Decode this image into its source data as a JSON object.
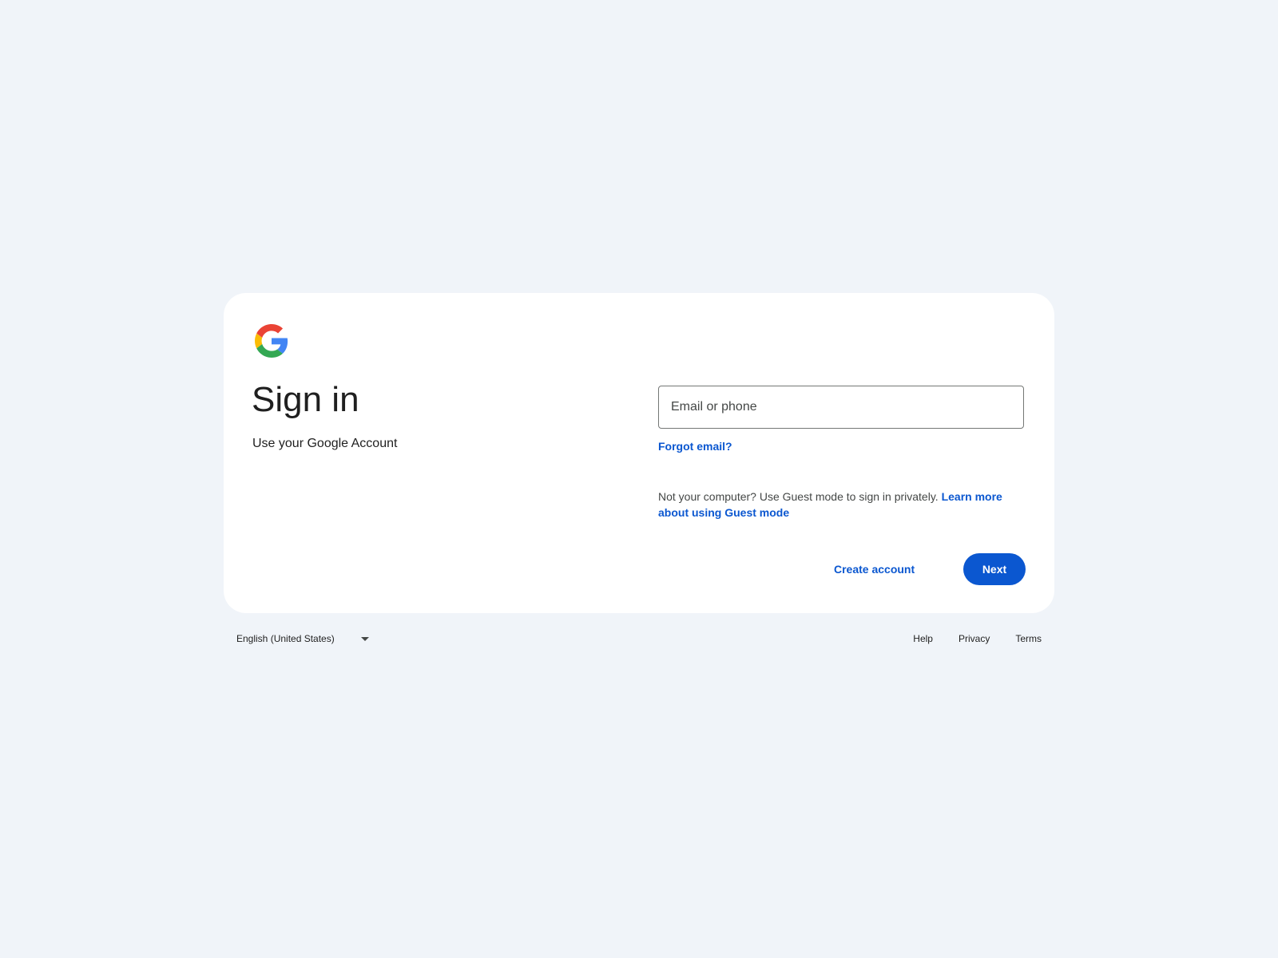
{
  "header": {
    "logo_icon": "google-g-logo",
    "title": "Sign in",
    "subtitle": "Use your Google Account"
  },
  "form": {
    "email_placeholder": "Email or phone",
    "email_value": "",
    "forgot_email_label": "Forgot email?",
    "guest_text": "Not your computer? Use Guest mode to sign in privately. ",
    "guest_link_label": "Learn more about using Guest mode"
  },
  "actions": {
    "create_account_label": "Create account",
    "next_label": "Next"
  },
  "footer": {
    "language_selected": "English (United States)",
    "links": [
      "Help",
      "Privacy",
      "Terms"
    ]
  },
  "colors": {
    "background": "#f0f4f9",
    "card": "#ffffff",
    "accent": "#0b57d0",
    "text": "#1f1f1f"
  }
}
